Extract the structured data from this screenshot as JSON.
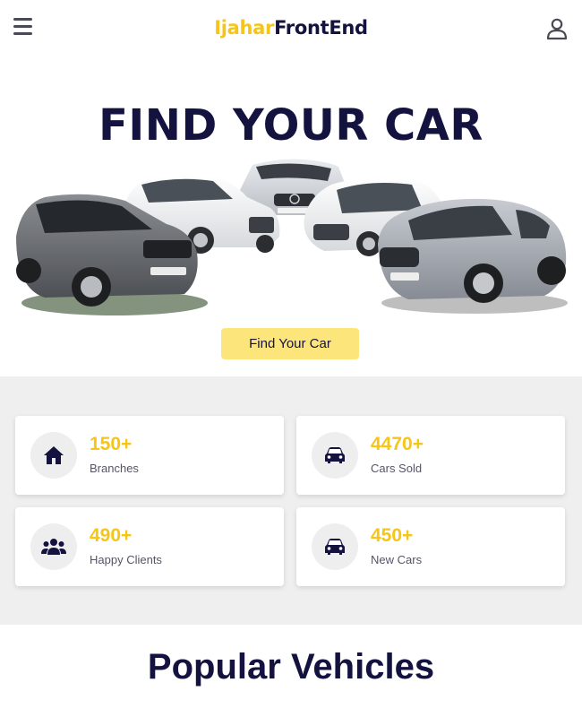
{
  "header": {
    "logo_part1": "Ijahar",
    "logo_part2": "FrontEnd",
    "menu_icon": "hamburger-menu-icon",
    "user_icon": "user-icon"
  },
  "hero": {
    "title": "FIND YOUR CAR",
    "button_label": "Find Your Car"
  },
  "stats": [
    {
      "value": "150+",
      "label": "Branches",
      "icon": "home-icon"
    },
    {
      "value": "4470+",
      "label": "Cars Sold",
      "icon": "car-icon"
    },
    {
      "value": "490+",
      "label": "Happy Clients",
      "icon": "users-icon"
    },
    {
      "value": "450+",
      "label": "New Cars",
      "icon": "car-icon"
    }
  ],
  "section": {
    "title_part1": "Popular",
    "title_part2": "Vehicles"
  },
  "colors": {
    "accent": "#f5c518",
    "navy": "#14123f",
    "button_bg": "#fce57a",
    "band_bg": "#efefef"
  }
}
